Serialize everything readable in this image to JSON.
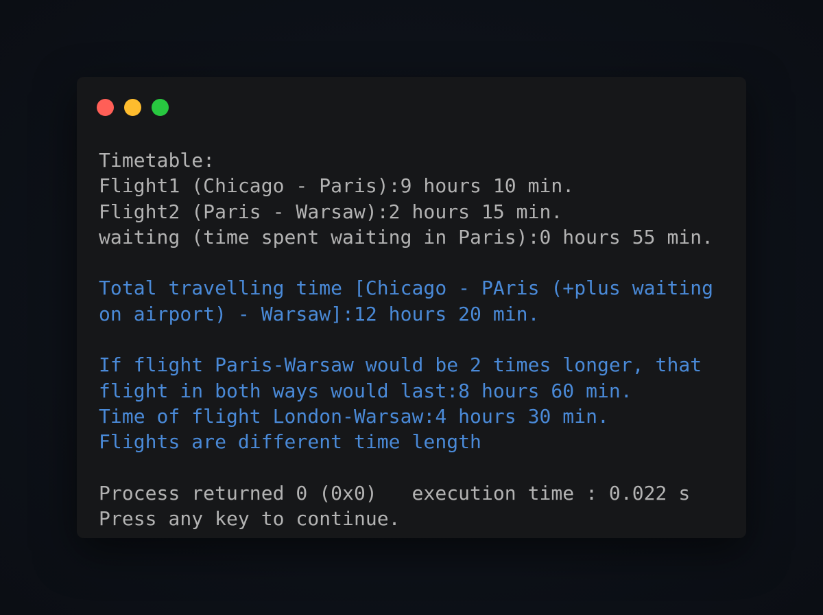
{
  "window": {
    "controls": [
      "close",
      "minimize",
      "maximize"
    ],
    "colors": {
      "close": "#ff5f57",
      "minimize": "#febc2e",
      "maximize": "#28c840",
      "text": "#b3b3b3",
      "highlight": "#4a8ad8"
    }
  },
  "terminal": {
    "lines": {
      "l1": "Timetable:",
      "l2": "Flight1 (Chicago - Paris):9 hours 10 min.",
      "l3": "Flight2 (Paris - Warsaw):2 hours 15 min.",
      "l4": "waiting (time spent waiting in Paris):0 hours 55 min.",
      "l5": "Total travelling time [Chicago - PAris (+plus waiting",
      "l6": "on airport) - Warsaw]:12 hours 20 min.",
      "l7": "If flight Paris-Warsaw would be 2 times longer, that",
      "l8": "flight in both ways would last:8 hours 60 min.",
      "l9": "Time of flight London-Warsaw:4 hours 30 min.",
      "l10": "Flights are different time length",
      "l11": "Process returned 0 (0x0)   execution time : 0.022 s",
      "l12": "Press any key to continue."
    }
  }
}
